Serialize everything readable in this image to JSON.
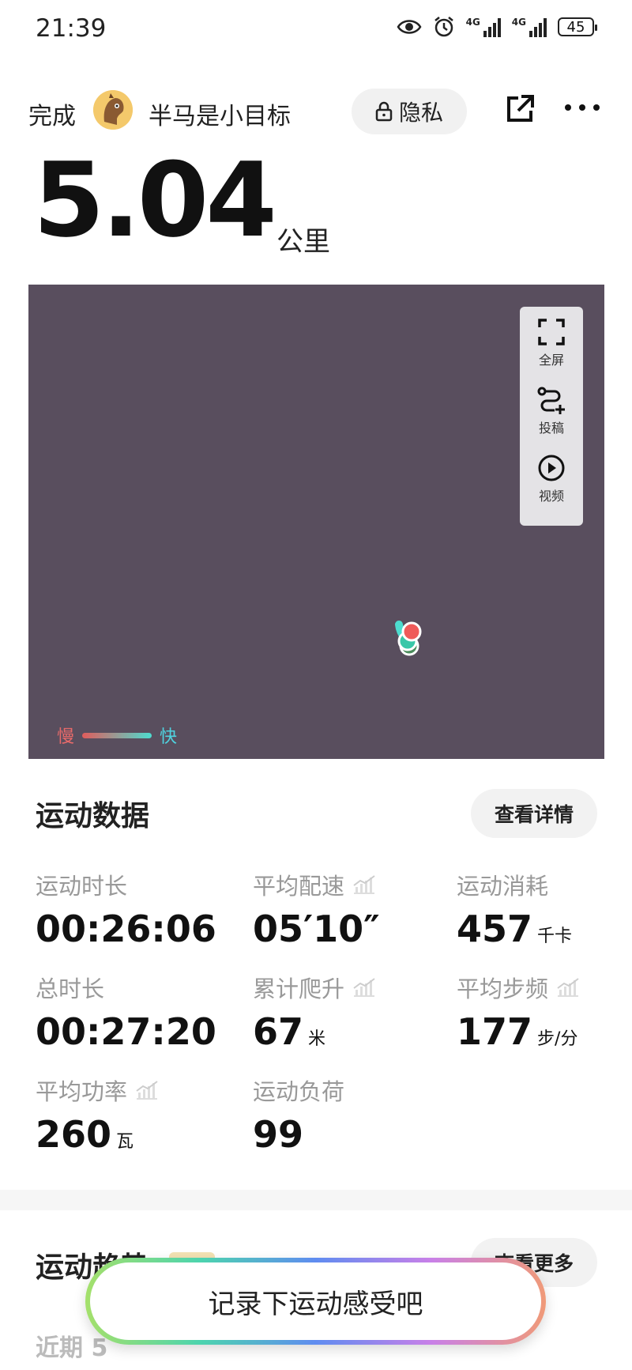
{
  "status_bar": {
    "time": "21:39",
    "network1": "4G",
    "network2": "4G",
    "battery": "45"
  },
  "header": {
    "done_label": "完成",
    "username": "半马是小目标",
    "privacy_label": "隐私"
  },
  "summary": {
    "distance": "5.04",
    "distance_unit": "公里"
  },
  "map": {
    "controls": {
      "fullscreen": "全屏",
      "submit": "投稿",
      "video": "视频"
    },
    "legend": {
      "slow": "慢",
      "fast": "快"
    },
    "colors": {
      "background": "#594e5e",
      "slow": "#e05c5c",
      "fast": "#4ddccf"
    }
  },
  "sport_data": {
    "title": "运动数据",
    "detail_button": "查看详情",
    "stats": [
      {
        "label": "运动时长",
        "value": "00:26:06",
        "unit": ""
      },
      {
        "label": "平均配速",
        "value": "05′10″",
        "unit": ""
      },
      {
        "label": "运动消耗",
        "value": "457",
        "unit": "千卡"
      },
      {
        "label": "总时长",
        "value": "00:27:20",
        "unit": ""
      },
      {
        "label": "累计爬升",
        "value": "67",
        "unit": "米"
      },
      {
        "label": "平均步频",
        "value": "177",
        "unit": "步/分"
      },
      {
        "label": "平均功率",
        "value": "260",
        "unit": "瓦"
      },
      {
        "label": "运动负荷",
        "value": "99",
        "unit": ""
      }
    ]
  },
  "trend": {
    "title": "运动趋势",
    "more_button": "查看更多",
    "recent": "近期 5"
  },
  "record_button": "记录下运动感受吧"
}
